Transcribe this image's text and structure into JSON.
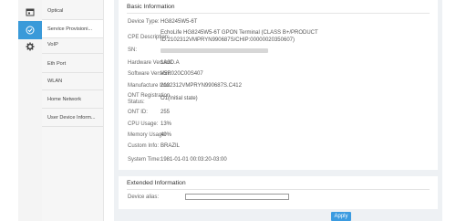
{
  "sidebar": {
    "icons": [
      {
        "name": "calendar-icon"
      },
      {
        "name": "check-circle-icon",
        "active": true
      },
      {
        "name": "gear-icon"
      }
    ],
    "items": [
      {
        "label": "Optical"
      },
      {
        "label": "Service Provisioni..."
      },
      {
        "label": "VoIP"
      },
      {
        "label": "Eth Port"
      },
      {
        "label": "WLAN"
      },
      {
        "label": "Home Network"
      },
      {
        "label": "User Device Inform..."
      }
    ]
  },
  "basic": {
    "title": "Basic Information",
    "device_type_label": "Device Type:",
    "device_type": "HG8245W5-6T",
    "cpe_label": "CPE Description:",
    "cpe_line1": "EchoLife HG8245W5-6T GPON Terminal (CLASS B+/PRODUCT",
    "cpe_line2": "ID:2102312VMPRYN990687S/CHIP:00000020350607)",
    "sn_label": "SN:",
    "hw_label": "Hardware Version:",
    "hw": "1A3D.A",
    "sw_label": "Software Version:",
    "sw": "V5R020C00S407",
    "mfg_label": "Manufacture Info:",
    "mfg": "2102312VMPRYN990687S.C412",
    "ont_status_label_1": "ONT Registration",
    "ont_status_label_2": "Status:",
    "ont_status": "O1(Initial state)",
    "ont_id_label": "ONT ID:",
    "ont_id": "255",
    "cpu_label": "CPU Usage:",
    "cpu": "13%",
    "mem_label": "Memory Usage:",
    "mem": "49%",
    "custom_label": "Custom Info:",
    "custom": "BRAZIL",
    "time_label": "System Time:",
    "time": "1981-01-01 00:03:20-03:00"
  },
  "extended": {
    "title": "Extended Information",
    "alias_label": "Device alias:",
    "alias_value": ""
  },
  "apply_label": "Apply"
}
